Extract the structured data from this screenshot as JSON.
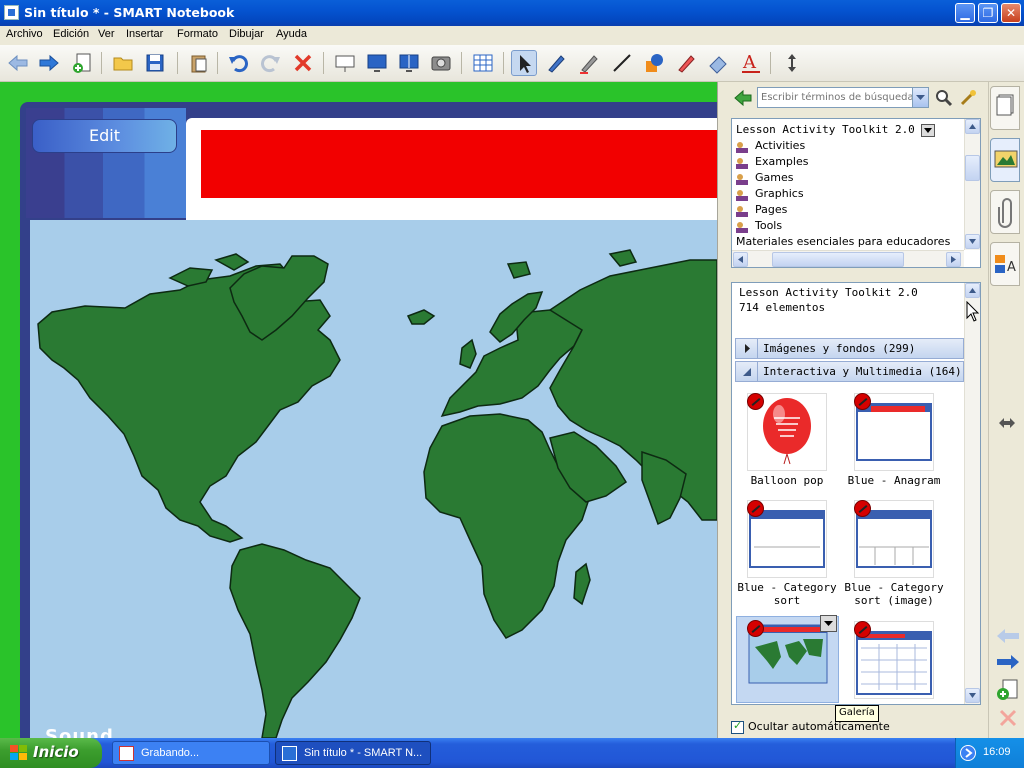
{
  "window": {
    "title": "Sin título * - SMART Notebook"
  },
  "menu": [
    "Archivo",
    "Edición",
    "Ver",
    "Insertar",
    "Formato",
    "Dibujar",
    "Ayuda"
  ],
  "page": {
    "edit_label": "Edit",
    "sound_label": "Sound"
  },
  "gallery": {
    "search_placeholder": "Escribir términos de búsqueda a",
    "tree": {
      "root": "Lesson Activity Toolkit 2.0",
      "items": [
        "Activities",
        "Examples",
        "Games",
        "Graphics",
        "Pages",
        "Tools"
      ],
      "next_root": "Materiales esenciales para educadores"
    },
    "collection": {
      "title": "Lesson Activity Toolkit 2.0",
      "count": "714 elementos"
    },
    "categories": [
      {
        "label": "Imágenes y fondos (299)",
        "expanded": false
      },
      {
        "label": "Interactiva y Multimedia (164)",
        "expanded": true
      }
    ],
    "thumbnails": [
      {
        "label_line1": "Balloon pop",
        "label_line2": ""
      },
      {
        "label_line1": "Blue - Anagram",
        "label_line2": ""
      },
      {
        "label_line1": "Blue - Category",
        "label_line2": "sort"
      },
      {
        "label_line1": "Blue - Category",
        "label_line2": "sort (image)"
      },
      {
        "label_line1": "",
        "label_line2": ""
      },
      {
        "label_line1": "",
        "label_line2": ""
      }
    ],
    "tooltip": "Galería",
    "autohide_label": "Ocultar automáticamente",
    "autohide_checked": true
  },
  "taskbar": {
    "start_label": "Inicio",
    "tasks": [
      "Grabando...",
      "Sin título * - SMART N..."
    ],
    "clock": "16:09"
  },
  "colors": {
    "workspace_green": "#2ac32a",
    "title_red": "#f20000",
    "ocean": "#a8cdea",
    "land": "#2a7a33"
  }
}
